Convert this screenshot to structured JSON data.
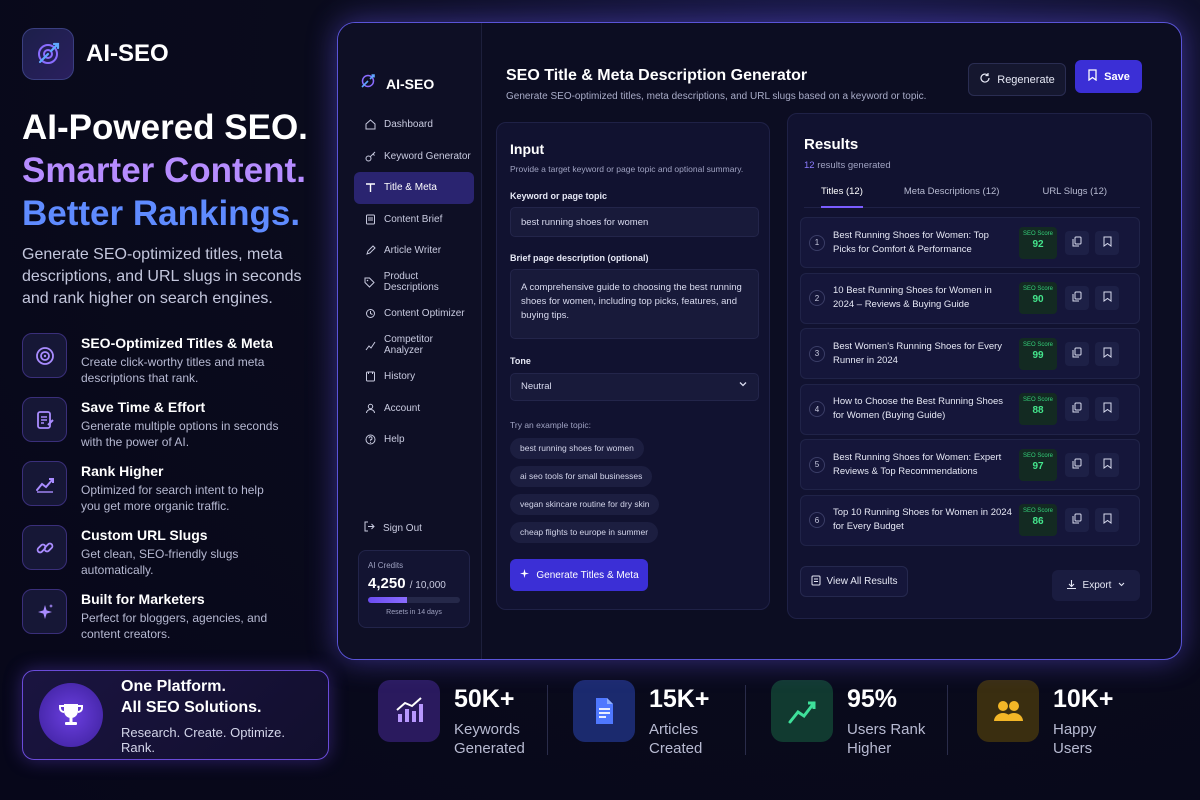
{
  "brand": {
    "name": "AI-SEO"
  },
  "hero": {
    "line1": "AI-Powered SEO.",
    "line2": "Smarter Content.",
    "line3": "Better Rankings.",
    "lead": "Generate SEO-optimized titles, meta descriptions, and URL slugs in seconds and rank higher on search engines."
  },
  "features": [
    {
      "icon": "target-icon",
      "title": "SEO-Optimized Titles & Meta",
      "desc": "Create click-worthy titles and meta descriptions that rank."
    },
    {
      "icon": "edit-document-icon",
      "title": "Save Time & Effort",
      "desc": "Generate multiple options in seconds with the power of AI."
    },
    {
      "icon": "trend-up-icon",
      "title": "Rank Higher",
      "desc": "Optimized for search intent to help you get more organic traffic."
    },
    {
      "icon": "link-icon",
      "title": "Custom URL Slugs",
      "desc": "Get clean, SEO-friendly slugs automatically."
    },
    {
      "icon": "sparkles-icon",
      "title": "Built for Marketers",
      "desc": "Perfect for bloggers, agencies, and content creators."
    }
  ],
  "platform": {
    "line1": "One Platform.",
    "line2": "All SEO Solutions.",
    "sub": "Research. Create. Optimize. Rank."
  },
  "stats": [
    {
      "value": "50K+",
      "label": "Keywords Generated",
      "icon": "bar-chart-icon",
      "color": "#6b3fe0"
    },
    {
      "value": "15K+",
      "label": "Articles Created",
      "icon": "document-icon",
      "color": "#3a5cf0"
    },
    {
      "value": "95%",
      "label": "Users Rank Higher",
      "icon": "growth-icon",
      "color": "#1fa97a"
    },
    {
      "value": "10K+",
      "label": "Happy Users",
      "icon": "users-icon",
      "color": "#e8a91c"
    }
  ],
  "app": {
    "brand": "AI-SEO",
    "nav": [
      {
        "label": "Dashboard",
        "icon": "home-icon",
        "active": false
      },
      {
        "label": "Keyword Generator",
        "icon": "key-icon",
        "active": false
      },
      {
        "label": "Title & Meta",
        "icon": "title-icon",
        "active": true
      },
      {
        "label": "Content Brief",
        "icon": "brief-icon",
        "active": false
      },
      {
        "label": "Article Writer",
        "icon": "pen-icon",
        "active": false
      },
      {
        "label": "Product Descriptions",
        "icon": "tag-icon",
        "active": false
      },
      {
        "label": "Content Optimizer",
        "icon": "optimizer-icon",
        "active": false
      },
      {
        "label": "Competitor Analyzer",
        "icon": "analyzer-icon",
        "active": false
      },
      {
        "label": "History",
        "icon": "history-icon",
        "active": false
      },
      {
        "label": "Account",
        "icon": "user-icon",
        "active": false
      },
      {
        "label": "Help",
        "icon": "help-icon",
        "active": false
      }
    ],
    "signout": "Sign Out",
    "credits": {
      "label": "AI Credits",
      "used": "4,250",
      "total": "/ 10,000",
      "fraction": 0.425,
      "reset": "Resets in 14 days"
    },
    "title": "SEO Title & Meta Description Generator",
    "subtitle": "Generate SEO-optimized titles, meta descriptions, and URL slugs based on a keyword or topic.",
    "regenerate": "Regenerate",
    "save": "Save",
    "input": {
      "heading": "Input",
      "sub": "Provide a target keyword or page topic and optional summary.",
      "keyword_label": "Keyword or page topic",
      "keyword_value": "best running shoes for women",
      "desc_label": "Brief page description (optional)",
      "desc_value": "A comprehensive guide to choosing the best running shoes for women, including top picks, features, and buying tips.",
      "tone_label": "Tone",
      "tone_value": "Neutral",
      "try_label": "Try an example topic:",
      "examples": [
        "best running shoes for women",
        "ai seo tools for small businesses",
        "vegan skincare routine for dry skin",
        "cheap flights to europe in summer"
      ],
      "generate": "Generate Titles & Meta"
    },
    "results": {
      "heading": "Results",
      "count": "12",
      "count_suffix": "results generated",
      "tabs": [
        "Titles (12)",
        "Meta Descriptions (12)",
        "URL Slugs (12)"
      ],
      "score_label": "SEO Score",
      "items": [
        {
          "num": "1",
          "text": "Best Running Shoes for Women: Top Picks for Comfort & Performance",
          "score": "92"
        },
        {
          "num": "2",
          "text": "10 Best Running Shoes for Women in 2024 – Reviews & Buying Guide",
          "score": "90"
        },
        {
          "num": "3",
          "text": "Best Women's Running Shoes for Every Runner in 2024",
          "score": "99"
        },
        {
          "num": "4",
          "text": "How to Choose the Best Running Shoes for Women (Buying Guide)",
          "score": "88"
        },
        {
          "num": "5",
          "text": "Best Running Shoes for Women: Expert Reviews & Top Recommendations",
          "score": "97"
        },
        {
          "num": "6",
          "text": "Top 10 Running Shoes for Women in 2024 for Every Budget",
          "score": "86"
        }
      ],
      "view_all": "View All Results",
      "export": "Export"
    }
  }
}
